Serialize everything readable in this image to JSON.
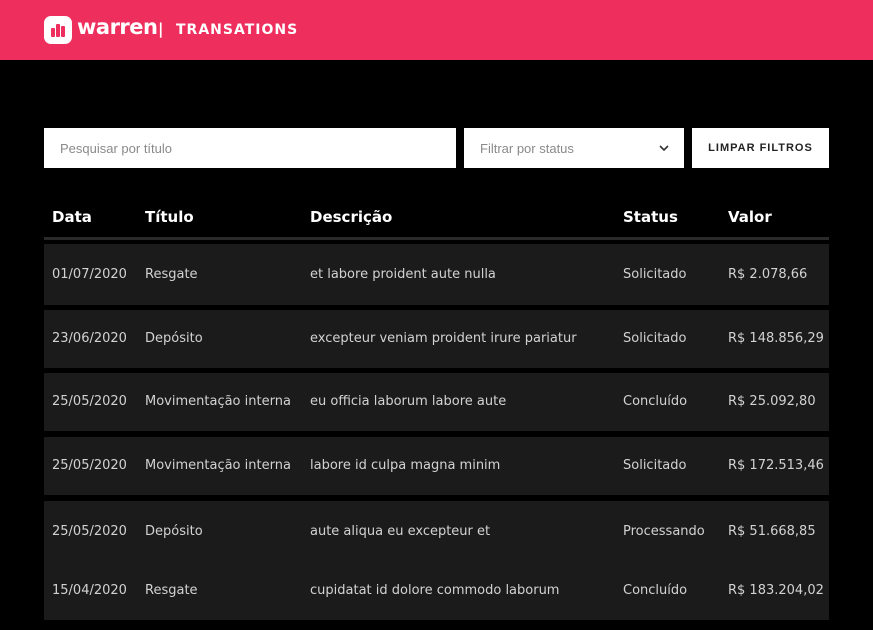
{
  "header": {
    "brand": "warren",
    "separator": "|",
    "title": "TRANSATIONS",
    "color": "#ee2e5d"
  },
  "filters": {
    "search_placeholder": "Pesquisar por título",
    "status_placeholder": "Filtrar por status",
    "clear_label": "LIMPAR FILTROS"
  },
  "table": {
    "columns": [
      "Data",
      "Título",
      "Descrição",
      "Status",
      "Valor"
    ],
    "rows": [
      {
        "date": "01/07/2020",
        "title": "Resgate",
        "description": "et labore proident aute nulla",
        "status": "Solicitado",
        "value": "R$ 2.078,66"
      },
      {
        "date": "23/06/2020",
        "title": "Depósito",
        "description": "excepteur veniam proident irure pariatur",
        "status": "Solicitado",
        "value": "R$ 148.856,29"
      },
      {
        "date": "25/05/2020",
        "title": "Movimentação interna",
        "description": "eu officia laborum labore aute",
        "status": "Concluído",
        "value": "R$ 25.092,80"
      },
      {
        "date": "25/05/2020",
        "title": "Movimentação interna",
        "description": "labore id culpa magna minim",
        "status": "Solicitado",
        "value": "R$ 172.513,46"
      },
      {
        "date": "25/05/2020",
        "title": "Depósito",
        "description": "aute aliqua eu excepteur et",
        "status": "Processando",
        "value": "R$ 51.668,85"
      },
      {
        "date": "15/04/2020",
        "title": "Resgate",
        "description": "cupidatat id dolore commodo laborum",
        "status": "Concluído",
        "value": "R$ 183.204,02"
      }
    ]
  }
}
